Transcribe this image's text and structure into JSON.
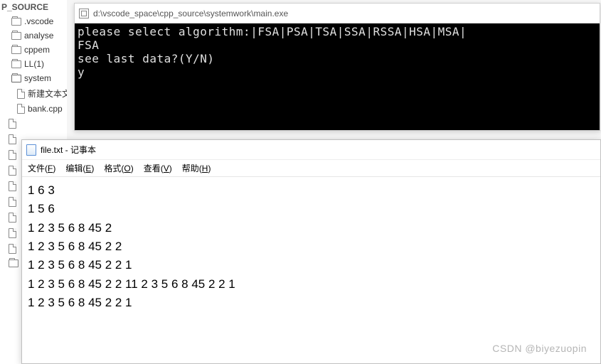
{
  "sidebar": {
    "root": "P_SOURCE",
    "folders": [
      {
        "label": ".vscode"
      },
      {
        "label": "analyse"
      },
      {
        "label": "cppem"
      },
      {
        "label": "LL(1)"
      },
      {
        "label": "system"
      }
    ],
    "files": [
      {
        "label": "新建文本文"
      },
      {
        "label": "bank.cpp"
      }
    ],
    "truncated_count": 9
  },
  "console": {
    "title": "d:\\vscode_space\\cpp_source\\systemwork\\main.exe",
    "lines": [
      "please select algorithm:|FSA|PSA|TSA|SSA|RSSA|HSA|MSA|",
      "FSA",
      "see last data?(Y/N)",
      "y"
    ]
  },
  "notepad": {
    "title": "file.txt - 记事本",
    "menu": [
      {
        "label": "文件",
        "key": "F"
      },
      {
        "label": "编辑",
        "key": "E"
      },
      {
        "label": "格式",
        "key": "O"
      },
      {
        "label": "查看",
        "key": "V"
      },
      {
        "label": "帮助",
        "key": "H"
      }
    ],
    "content": [
      "1 6 3",
      "1 5 6",
      "1 2 3 5 6 8 45 2",
      "1 2 3 5 6 8 45 2 2",
      "1 2 3 5 6 8 45 2 2 1",
      "1 2 3 5 6 8 45 2 2 11 2 3 5 6 8 45 2 2 1",
      "1 2 3 5 6 8 45 2 2 1"
    ]
  },
  "watermark": "CSDN @biyezuopin"
}
